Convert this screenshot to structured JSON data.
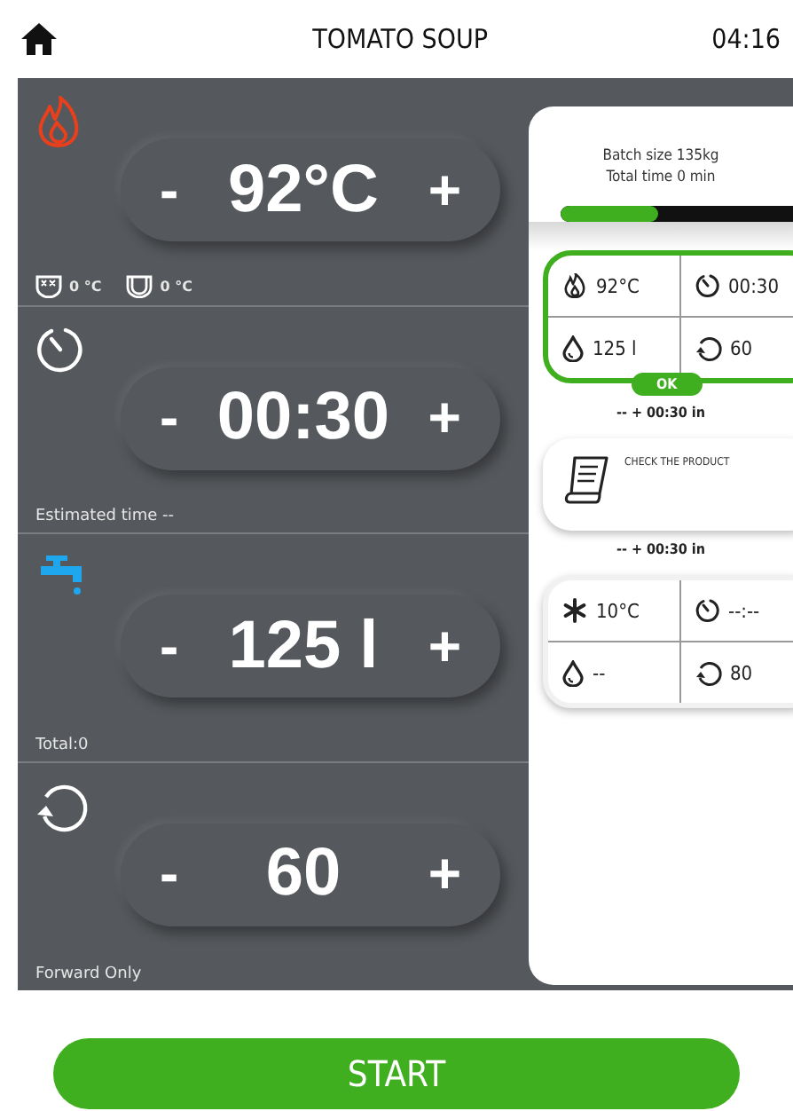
{
  "header": {
    "title": "TOMATO SOUP",
    "time": "04:16"
  },
  "controls": [
    {
      "kind": "heat",
      "decrease": "-",
      "value": "92°C",
      "increase": "+",
      "readings": [
        {
          "kind": "jacket",
          "text": "0 °C"
        },
        {
          "kind": "tank",
          "text": "0 °C"
        }
      ]
    },
    {
      "kind": "time",
      "decrease": "-",
      "value": "00:30",
      "increase": "+",
      "note": "Estimated time --"
    },
    {
      "kind": "water",
      "decrease": "-",
      "value": "125 l",
      "increase": "+",
      "note": "Total:0"
    },
    {
      "kind": "mixing",
      "decrease": "-",
      "value": "60",
      "increase": "+",
      "note": "Forward Only"
    }
  ],
  "batch": {
    "size": "Batch size 135kg",
    "time": "Total time 0 min",
    "level": 0.42
  },
  "steps": [
    {
      "kind": "params",
      "selected": true,
      "status": "OK",
      "cells": [
        {
          "kind": "flame",
          "text": "92°C"
        },
        {
          "kind": "timer",
          "text": "00:30"
        },
        {
          "kind": "drop",
          "text": "125 l"
        },
        {
          "kind": "rotate",
          "text": "60"
        }
      ]
    },
    {
      "kind": "timing",
      "text": "-- + 00:30 in"
    },
    {
      "kind": "action",
      "text": "CHECK THE PRODUCT"
    },
    {
      "kind": "timing",
      "text": "-- + 00:30 in"
    },
    {
      "kind": "params",
      "selected": false,
      "cells": [
        {
          "kind": "snowflake",
          "text": "10°C"
        },
        {
          "kind": "timer",
          "text": "--:--"
        },
        {
          "kind": "drop",
          "text": "--"
        },
        {
          "kind": "rotate",
          "text": "80"
        }
      ]
    }
  ],
  "start": "START"
}
